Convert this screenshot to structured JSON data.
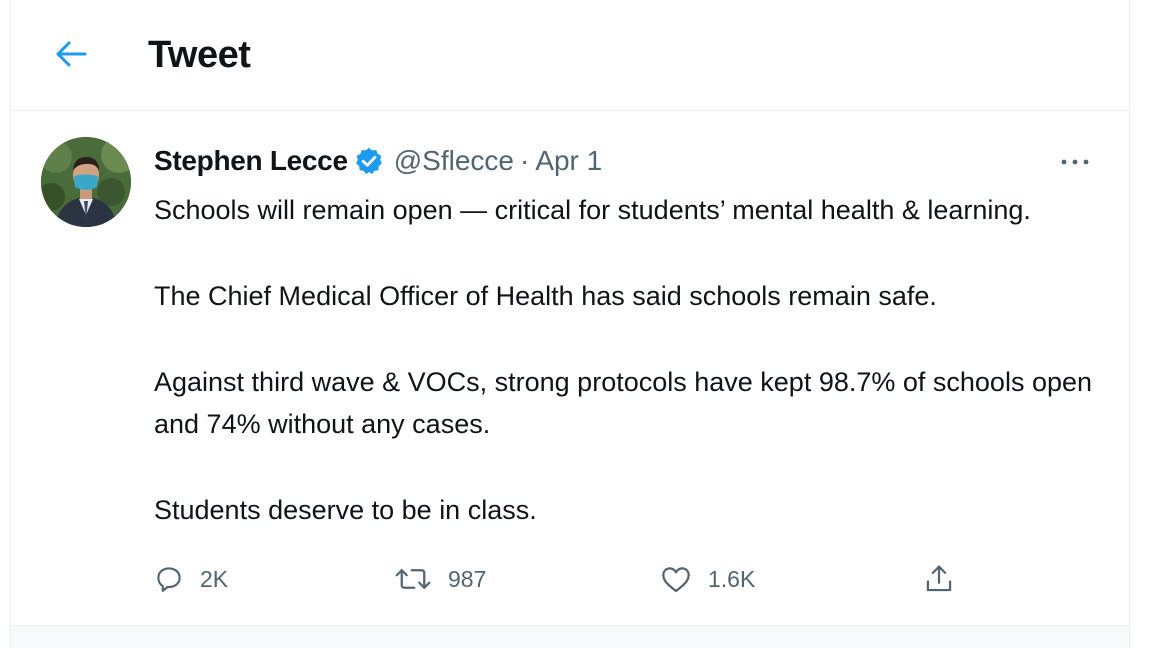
{
  "header": {
    "back_icon": "arrow-left-icon",
    "title": "Tweet"
  },
  "tweet": {
    "author_name": "Stephen Lecce",
    "verified_icon": "verified-badge-icon",
    "handle": "@Sflecce",
    "separator": "·",
    "date": "Apr 1",
    "more_icon": "more-horizontal-icon",
    "paragraphs": [
      "Schools will remain open — critical for students’ mental health & learning.",
      "The Chief Medical Officer of Health has said schools remain safe.",
      "Against third wave & VOCs, strong protocols have kept 98.7% of schools open and 74% without any cases.",
      "Students deserve to be in class."
    ],
    "actions": {
      "reply_count": "2K",
      "retweet_count": "987",
      "like_count": "1.6K"
    }
  },
  "colors": {
    "accent": "#1d9bf0",
    "text": "#0f1419",
    "secondary": "#536471",
    "border": "#eceff1"
  }
}
